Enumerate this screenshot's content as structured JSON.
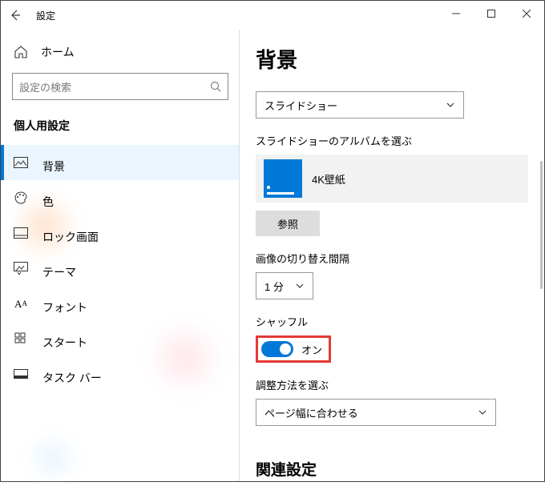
{
  "window": {
    "title": "設定"
  },
  "sidebar": {
    "home_label": "ホーム",
    "search_placeholder": "設定の検索",
    "section_heading": "個人用設定",
    "items": [
      {
        "label": "背景",
        "selected": true,
        "icon": "picture-icon"
      },
      {
        "label": "色",
        "selected": false,
        "icon": "palette-icon"
      },
      {
        "label": "ロック画面",
        "selected": false,
        "icon": "lock-screen-icon"
      },
      {
        "label": "テーマ",
        "selected": false,
        "icon": "theme-icon"
      },
      {
        "label": "フォント",
        "selected": false,
        "icon": "font-icon"
      },
      {
        "label": "スタート",
        "selected": false,
        "icon": "start-icon"
      },
      {
        "label": "タスク バー",
        "selected": false,
        "icon": "taskbar-icon"
      }
    ]
  },
  "content": {
    "heading": "背景",
    "background_mode": "スライドショー",
    "album_label": "スライドショーのアルバムを選ぶ",
    "album_name": "4K壁紙",
    "browse_button": "参照",
    "interval_label": "画像の切り替え間隔",
    "interval_value": "1 分",
    "shuffle_label": "シャッフル",
    "shuffle_state_text": "オン",
    "shuffle_state": true,
    "fit_label": "調整方法を選ぶ",
    "fit_value": "ページ幅に合わせる",
    "related_heading": "関連設定"
  },
  "colors": {
    "accent": "#0078d7",
    "highlight_border": "#e53935"
  }
}
